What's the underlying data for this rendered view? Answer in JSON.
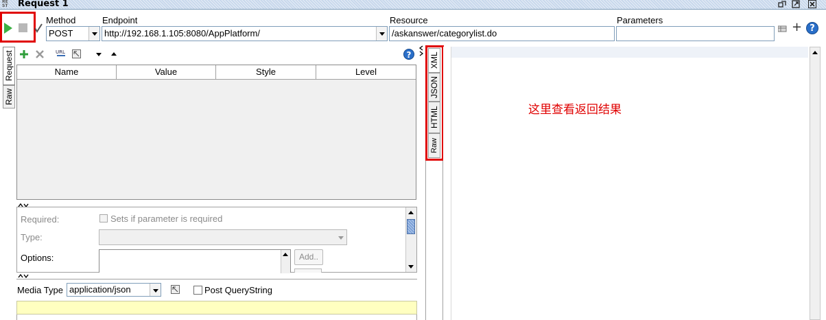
{
  "window": {
    "title": "Request 1",
    "title_icon_text": "RE ST"
  },
  "toolbar": {
    "method_label": "Method",
    "method_value": "POST",
    "endpoint_label": "Endpoint",
    "endpoint_value": "http://192.168.1.105:8080/AppPlatform/",
    "resource_label": "Resource",
    "resource_value": "/askanswer/categorylist.do",
    "parameters_label": "Parameters",
    "parameters_value": "",
    "add_symbol": "+",
    "help_symbol": "?"
  },
  "left_tabs": {
    "request": "Request",
    "raw": "Raw"
  },
  "params_table": {
    "columns": [
      "Name",
      "Value",
      "Style",
      "Level"
    ],
    "rows": []
  },
  "param_details": {
    "required_label": "Required:",
    "required_checkbox_text": "Sets if parameter is required",
    "type_label": "Type:",
    "type_value": "",
    "options_label": "Options:",
    "add_button": "Add.."
  },
  "media": {
    "label": "Media Type",
    "value": "application/json",
    "post_querystring_label": "Post QueryString"
  },
  "response_tabs": [
    "XML",
    "JSON",
    "HTML",
    "Raw"
  ],
  "response": {
    "annotation": "这里查看返回结果"
  },
  "colors": {
    "accent_red": "#e00000",
    "highlight_yellow": "#ffffc0",
    "play_green": "#3cb043",
    "help_blue": "#2a6fc9"
  },
  "icons": [
    "play-icon",
    "stop-icon",
    "check-icon",
    "plus-icon",
    "delete-icon",
    "uri-icon",
    "resize-icon",
    "chevron-down-icon",
    "chevron-up-icon",
    "help-icon",
    "restore-icon",
    "maximize-icon",
    "close-icon"
  ]
}
